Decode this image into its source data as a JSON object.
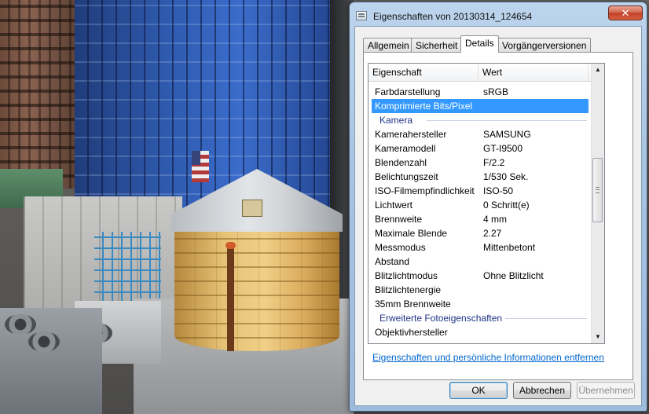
{
  "window": {
    "title": "Eigenschaften von 20130314_124654",
    "close_symbol": "✕"
  },
  "tabs": [
    {
      "label": "Allgemein"
    },
    {
      "label": "Sicherheit"
    },
    {
      "label": "Details",
      "active": true
    },
    {
      "label": "Vorgängerversionen"
    }
  ],
  "list": {
    "headers": {
      "property": "Eigenschaft",
      "value": "Wert"
    },
    "rows": [
      {
        "property": "Farbdarstellung",
        "value": "sRGB"
      },
      {
        "property": "Komprimierte Bits/Pixel",
        "value": "",
        "selected": true
      },
      {
        "group": "Kamera"
      },
      {
        "property": "Kamerahersteller",
        "value": "SAMSUNG"
      },
      {
        "property": "Kameramodell",
        "value": "GT-I9500"
      },
      {
        "property": "Blendenzahl",
        "value": "F/2.2"
      },
      {
        "property": "Belichtungszeit",
        "value": "1/530 Sek."
      },
      {
        "property": "ISO-Filmempfindlichkeit",
        "value": "ISO-50"
      },
      {
        "property": "Lichtwert",
        "value": "0 Schritt(e)"
      },
      {
        "property": "Brennweite",
        "value": "4 mm"
      },
      {
        "property": "Maximale Blende",
        "value": "2.27"
      },
      {
        "property": "Messmodus",
        "value": "Mittenbetont"
      },
      {
        "property": "Abstand",
        "value": ""
      },
      {
        "property": "Blitzlichtmodus",
        "value": "Ohne Blitzlicht"
      },
      {
        "property": "Blitzlichtenergie",
        "value": ""
      },
      {
        "property": "35mm Brennweite",
        "value": ""
      },
      {
        "group": "Erweiterte Fotoeigenschaften"
      },
      {
        "property": "Objektivhersteller",
        "value": ""
      }
    ]
  },
  "link": "Eigenschaften und persönliche Informationen entfernen",
  "buttons": {
    "ok": "OK",
    "cancel": "Abbrechen",
    "apply": "Übernehmen"
  },
  "colors": {
    "selection": "#3399ff",
    "group_header": "#1e3287",
    "link": "#0066cc"
  }
}
